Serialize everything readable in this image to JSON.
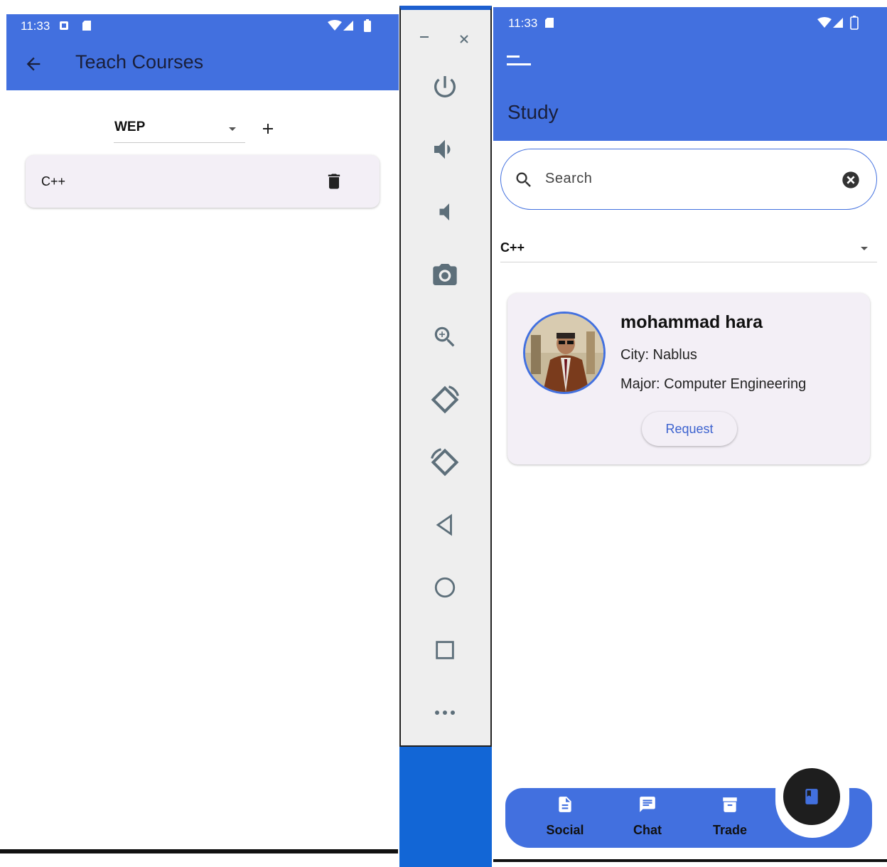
{
  "left_screen": {
    "status_time": "11:33",
    "title": "Teach Courses",
    "dropdown_value": "WEP",
    "courses": [
      {
        "name": "C++"
      }
    ]
  },
  "emulator_toolbar": {
    "items": [
      "minimize",
      "close",
      "power",
      "volume-up",
      "volume-down",
      "camera",
      "zoom",
      "rotate-left",
      "rotate-right",
      "back",
      "home",
      "overview",
      "more"
    ]
  },
  "right_screen": {
    "status_time": "11:33",
    "title": "Study",
    "search": {
      "placeholder": "Search"
    },
    "course_filter": "C++",
    "tutor": {
      "name": "mohammad hara",
      "city": "City: Nablus",
      "major": "Major: Computer Engineering",
      "request_label": "Request"
    },
    "nav": {
      "social": "Social",
      "chat": "Chat",
      "trade": "Trade"
    }
  },
  "colors": {
    "appbar": "#4270DF",
    "card": "#f3eff6",
    "fab": "#1e1e1e",
    "emulator_bg": "#eeeeee",
    "emulator_blue": "#1266d6"
  }
}
